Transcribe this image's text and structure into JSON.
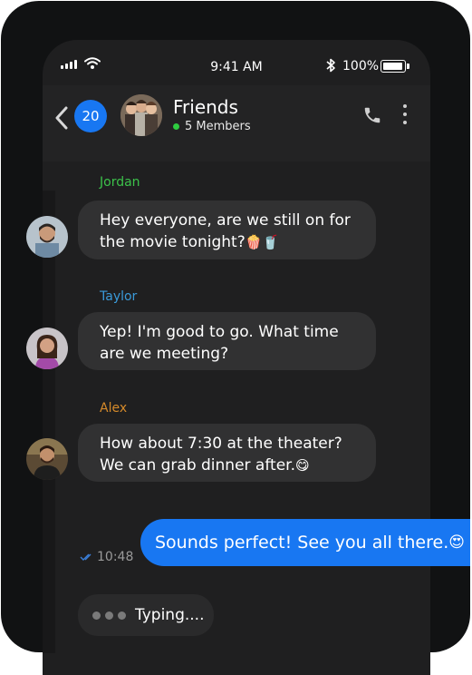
{
  "status": {
    "time": "9:41 AM",
    "battery": "100%"
  },
  "header": {
    "unread_count": "20",
    "group_name": "Friends",
    "members": "5 Members"
  },
  "messages": [
    {
      "sender": "Jordan",
      "sender_color": "#3cc24a",
      "text": "Hey everyone, are we still on for the movie tonight?",
      "emoji": "🍿🥤"
    },
    {
      "sender": "Taylor",
      "sender_color": "#3a9ad9",
      "text": "Yep! I'm good to go. What time are we meeting?",
      "emoji": ""
    },
    {
      "sender": "Alex",
      "sender_color": "#d58a2a",
      "text": "How about 7:30 at the theater? We can grab dinner after.",
      "emoji": "😋"
    }
  ],
  "outgoing": {
    "text": "Sounds perfect! See you all there.",
    "emoji": "😍",
    "time": "10:48"
  },
  "typing": {
    "label": "Typing...."
  },
  "colors": {
    "accent": "#1877f2",
    "online": "#2ecc40"
  }
}
